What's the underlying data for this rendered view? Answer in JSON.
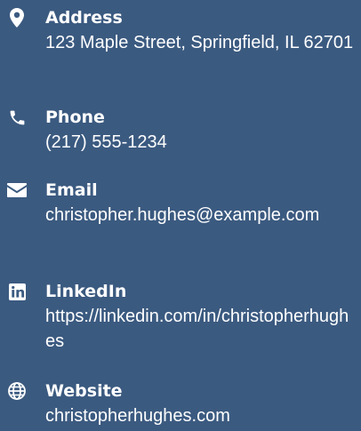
{
  "contacts": {
    "address": {
      "icon": "map-marker-icon",
      "label": "Address",
      "value": "123 Maple Street, Springfield, IL 62701"
    },
    "phone": {
      "icon": "phone-icon",
      "label": "Phone",
      "value": "(217) 555-1234"
    },
    "email": {
      "icon": "envelope-icon",
      "label": "Email",
      "value": "christopher.hughes@example.com"
    },
    "linkedin": {
      "icon": "linkedin-icon",
      "label": "LinkedIn",
      "value": "https://linkedin.com/in/christopherhughes"
    },
    "website": {
      "icon": "globe-icon",
      "label": "Website",
      "value": "christopherhughes.com"
    }
  },
  "colors": {
    "background": "#3b5a80",
    "text": "#ffffff"
  }
}
